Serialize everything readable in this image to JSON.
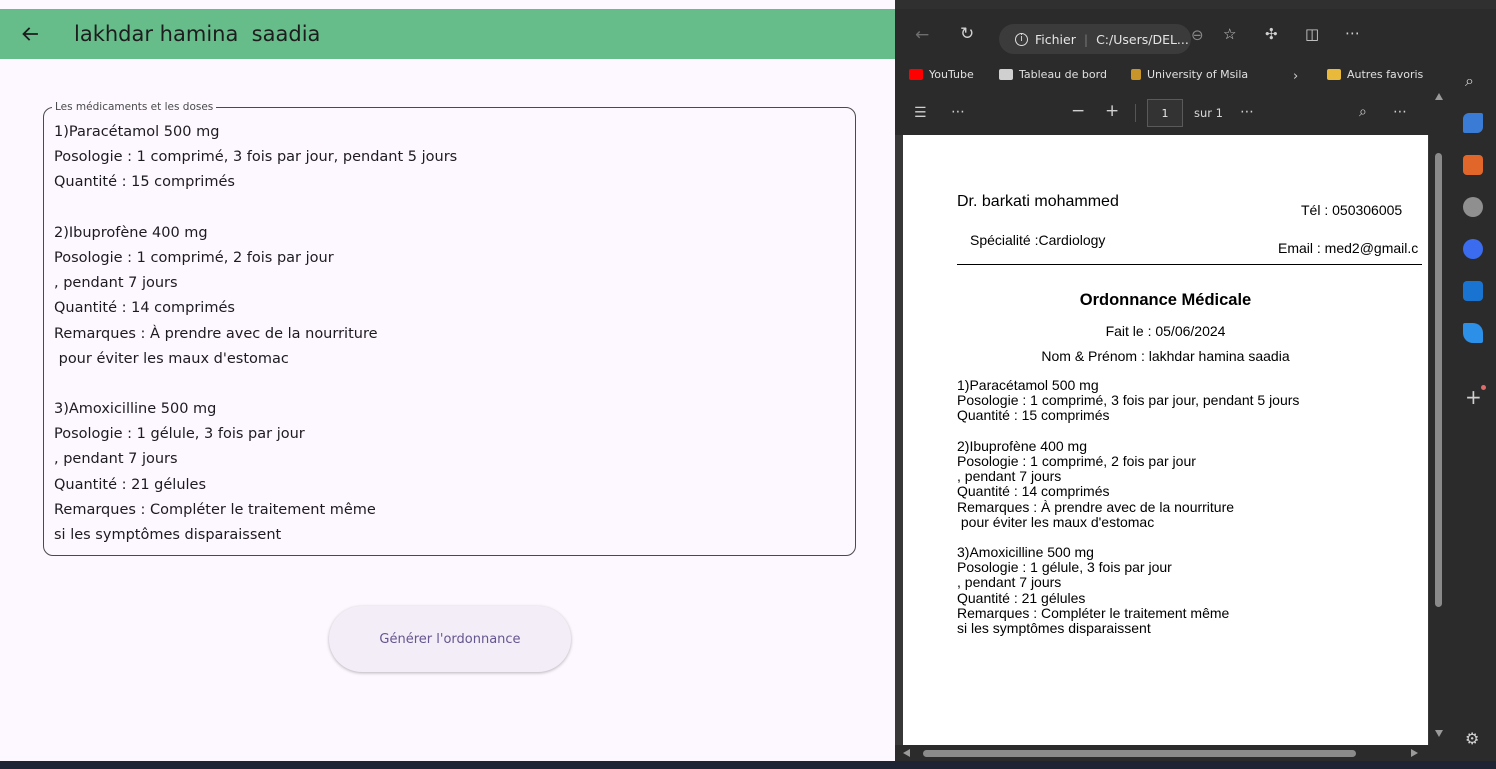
{
  "app": {
    "title": "lakhdar hamina  saadia",
    "field_label": "Les médicaments et les doses",
    "field_lines": [
      "1)Paracétamol 500 mg",
      "Posologie : 1 comprimé, 3 fois par jour, pendant 5 jours",
      "Quantité : 15 comprimés",
      "",
      "2)Ibuprofène 400 mg",
      "Posologie : 1 comprimé, 2 fois par jour",
      ", pendant 7 jours",
      "Quantité : 14 comprimés",
      "Remarques : À prendre avec de la nourriture",
      " pour éviter les maux d'estomac",
      "",
      "3)Amoxicilline 500 mg",
      "Posologie : 1 gélule, 3 fois par jour",
      ", pendant 7 jours",
      "Quantité : 21 gélules",
      "Remarques : Compléter le traitement même",
      "si les symptômes disparaissent"
    ],
    "generate_button": "Générer l'ordonnance",
    "accent_color": "#66bd8a"
  },
  "browser": {
    "address_prefix": "Fichier",
    "address": "C:/Users/DEL...",
    "bookmarks": [
      "YouTube",
      "Tableau de bord",
      "University of Msila"
    ],
    "other_favorites": "Autres favoris",
    "pdf_toolbar": {
      "page_number": "1",
      "page_total": "sur 1"
    }
  },
  "pdf": {
    "doctor": "Dr. barkati mohammed",
    "phone": "Tél : 050306005",
    "specialty": "Spécialité :Cardiology",
    "email": "Email : med2@gmail.c",
    "heading": "Ordonnance Médicale",
    "date": "Fait le : 05/06/2024",
    "patient": "Nom & Prénom : lakhdar hamina saadia",
    "lines": [
      "1)Paracétamol 500 mg",
      "Posologie : 1 comprimé, 3 fois par jour, pendant 5 jours",
      "Quantité : 15 comprimés",
      "",
      "2)Ibuprofène 400 mg",
      "Posologie : 1 comprimé, 2 fois par jour",
      ", pendant 7 jours",
      "Quantité : 14 comprimés",
      "Remarques : À prendre avec de la nourriture",
      " pour éviter les maux d'estomac",
      "",
      "3)Amoxicilline 500 mg",
      "Posologie : 1 gélule, 3 fois par jour",
      ", pendant 7 jours",
      "Quantité : 21 gélules",
      "Remarques : Compléter le traitement même",
      "si les symptômes disparaissent"
    ]
  }
}
